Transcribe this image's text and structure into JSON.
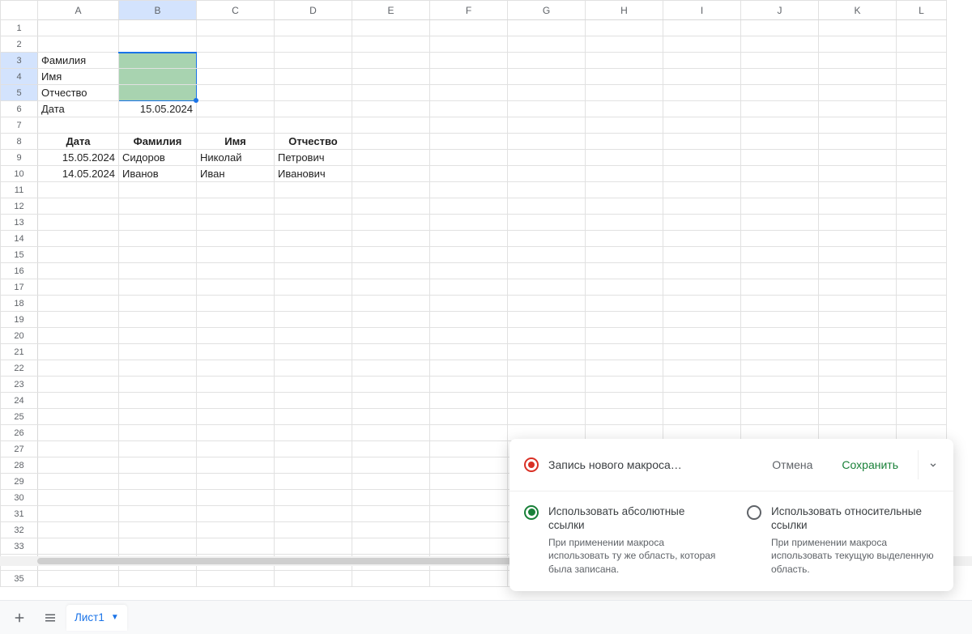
{
  "columns": [
    "A",
    "B",
    "C",
    "D",
    "E",
    "F",
    "G",
    "H",
    "I",
    "J",
    "K",
    "L"
  ],
  "row_count": 35,
  "selected_cols": [
    "B"
  ],
  "selected_rows": [
    3,
    4,
    5
  ],
  "cells": {
    "A3": "Фамилия",
    "A4": "Имя",
    "A5": "Отчество",
    "A6": "Дата",
    "B6": "15.05.2024",
    "A8": "Дата",
    "B8": "Фамилия",
    "C8": "Имя",
    "D8": "Отчество",
    "A9": "15.05.2024",
    "B9": "Сидоров",
    "C9": "Николай",
    "D9": "Петрович",
    "A10": "14.05.2024",
    "B10": "Иванов",
    "C10": "Иван",
    "D10": "Иванович"
  },
  "macro": {
    "title": "Запись нового макроса…",
    "cancel": "Отмена",
    "save": "Сохранить",
    "opt1_title": "Использовать абсолютные ссылки",
    "opt1_desc": "При применении макроса использовать ту же область, которая была записана.",
    "opt2_title": "Использовать относительные ссылки",
    "opt2_desc": "При применении макроса использовать текущую выделенную область."
  },
  "sheet_tab": "Лист1"
}
